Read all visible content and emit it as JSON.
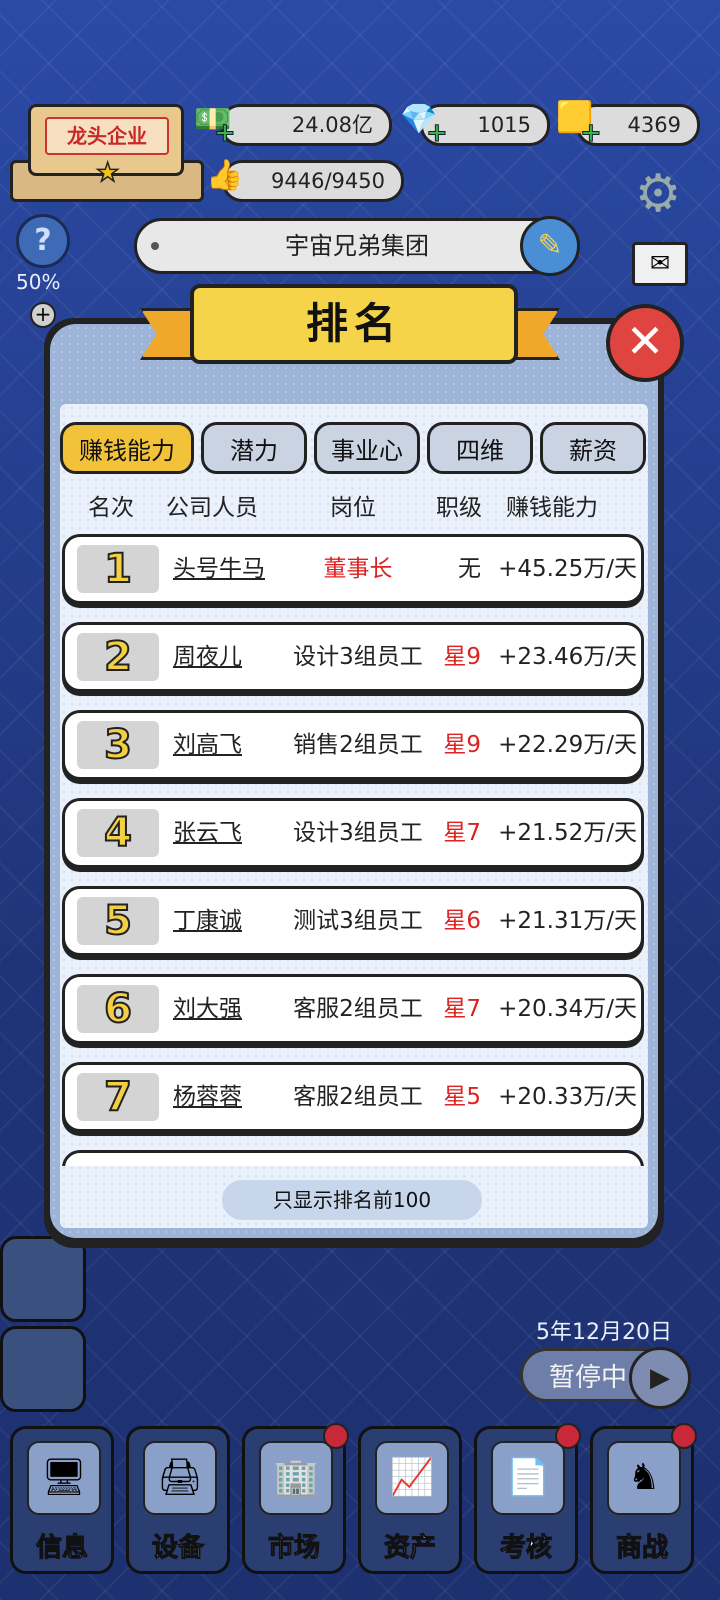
{
  "hud": {
    "company_level": "龙头企业",
    "money": "24.08亿",
    "diamonds": "1015",
    "gold": "4369",
    "likes": "9446/9450",
    "company_name": "宇宙兄弟集团",
    "help_percent": "50%"
  },
  "modal": {
    "title": "排名",
    "tabs": [
      "赚钱能力",
      "潜力",
      "事业心",
      "四维",
      "薪资"
    ],
    "active_tab": "赚钱能力",
    "columns": [
      "名次",
      "公司人员",
      "岗位",
      "职级",
      "赚钱能力"
    ],
    "rows": [
      {
        "rank": "1",
        "name": "头号牛马",
        "post": "董事长",
        "level": "无",
        "earn": "+45.25万/天"
      },
      {
        "rank": "2",
        "name": "周夜儿",
        "post": "设计3组员工",
        "level": "星9",
        "earn": "+23.46万/天"
      },
      {
        "rank": "3",
        "name": "刘高飞",
        "post": "销售2组员工",
        "level": "星9",
        "earn": "+22.29万/天"
      },
      {
        "rank": "4",
        "name": "张云飞",
        "post": "设计3组员工",
        "level": "星7",
        "earn": "+21.52万/天"
      },
      {
        "rank": "5",
        "name": "丁康诚",
        "post": "测试3组员工",
        "level": "星6",
        "earn": "+21.31万/天"
      },
      {
        "rank": "6",
        "name": "刘大强",
        "post": "客服2组员工",
        "level": "星7",
        "earn": "+20.34万/天"
      },
      {
        "rank": "7",
        "name": "杨蓉蓉",
        "post": "客服2组员工",
        "level": "星5",
        "earn": "+20.33万/天"
      }
    ],
    "footnote": "只显示排名前100"
  },
  "game": {
    "date": "5年12月20日",
    "pause_label": "暂停中"
  },
  "nav": [
    "信息",
    "设备",
    "市场",
    "资产",
    "考核",
    "商战"
  ],
  "colors": {
    "accent": "#f3c23b",
    "red": "#d22222",
    "close": "#e04440"
  }
}
